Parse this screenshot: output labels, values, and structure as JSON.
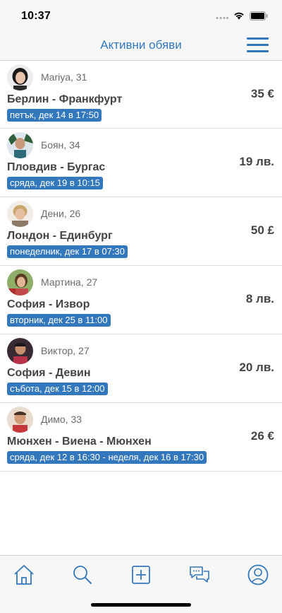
{
  "status": {
    "time": "10:37"
  },
  "header": {
    "title": "Активни обяви"
  },
  "colors": {
    "accent": "#3378bd"
  },
  "rides": [
    {
      "person": "Mariya, 31",
      "route": "Берлин - Франкфурт",
      "date": "петък, дек 14 в 17:50",
      "price": "35 €"
    },
    {
      "person": "Боян, 34",
      "route": "Пловдив - Бургас",
      "date": "сряда, дек 19 в 10:15",
      "price": "19 лв."
    },
    {
      "person": "Дени, 26",
      "route": "Лондон - Единбург",
      "date": "понеделник, дек 17 в 07:30",
      "price": "50 £"
    },
    {
      "person": "Мартина, 27",
      "route": "София - Извор",
      "date": "вторник, дек 25 в 11:00",
      "price": "8 лв."
    },
    {
      "person": "Виктор, 27",
      "route": "София - Девин",
      "date": "събота, дек 15 в 12:00",
      "price": "20 лв."
    },
    {
      "person": "Димо, 33",
      "route": "Мюнхен - Виена - Мюнхен",
      "date": "сряда, дек 12 в 16:30  -  неделя, дек 16 в 17:30",
      "price": "26 €"
    }
  ],
  "tabs": [
    {
      "icon": "home-icon"
    },
    {
      "icon": "search-icon"
    },
    {
      "icon": "add-icon"
    },
    {
      "icon": "chat-icon"
    },
    {
      "icon": "profile-icon"
    }
  ]
}
